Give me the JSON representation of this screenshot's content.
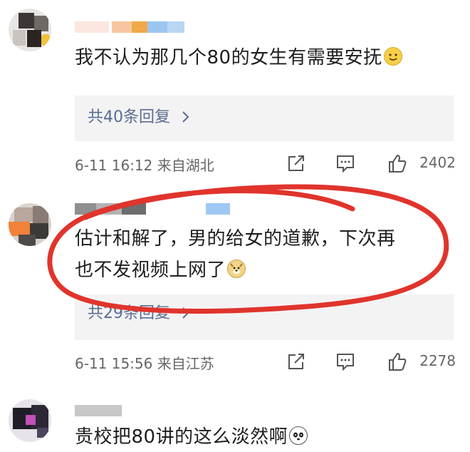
{
  "comments": [
    {
      "text": "我不认为那几个80的女生有需要安抚",
      "emoji": "smile-emoji",
      "replies_label": "共40条回复",
      "date_location": "6-11 16:12 来自湖北",
      "like_count": "2402"
    },
    {
      "text_line1": "估计和解了，男的给女的道歉，下次再",
      "text_line2": "也不发视频上网了",
      "emoji": "doge-emoji",
      "replies_label": "共29条回复",
      "date_location": "6-11 15:56 来自江苏",
      "like_count": "2278"
    },
    {
      "text": "贵校把80讲的这么淡然啊",
      "emoji": "panda-emoji"
    }
  ],
  "icons": {
    "share": "share-icon",
    "comment": "comment-icon",
    "like": "thumbs-up-icon",
    "chevron": "chevron-right-icon"
  },
  "colors": {
    "link_blue": "#5a6d92",
    "meta_gray": "#666666",
    "annotation_red": "#e0342c",
    "reply_bg": "#f3f3f3"
  }
}
